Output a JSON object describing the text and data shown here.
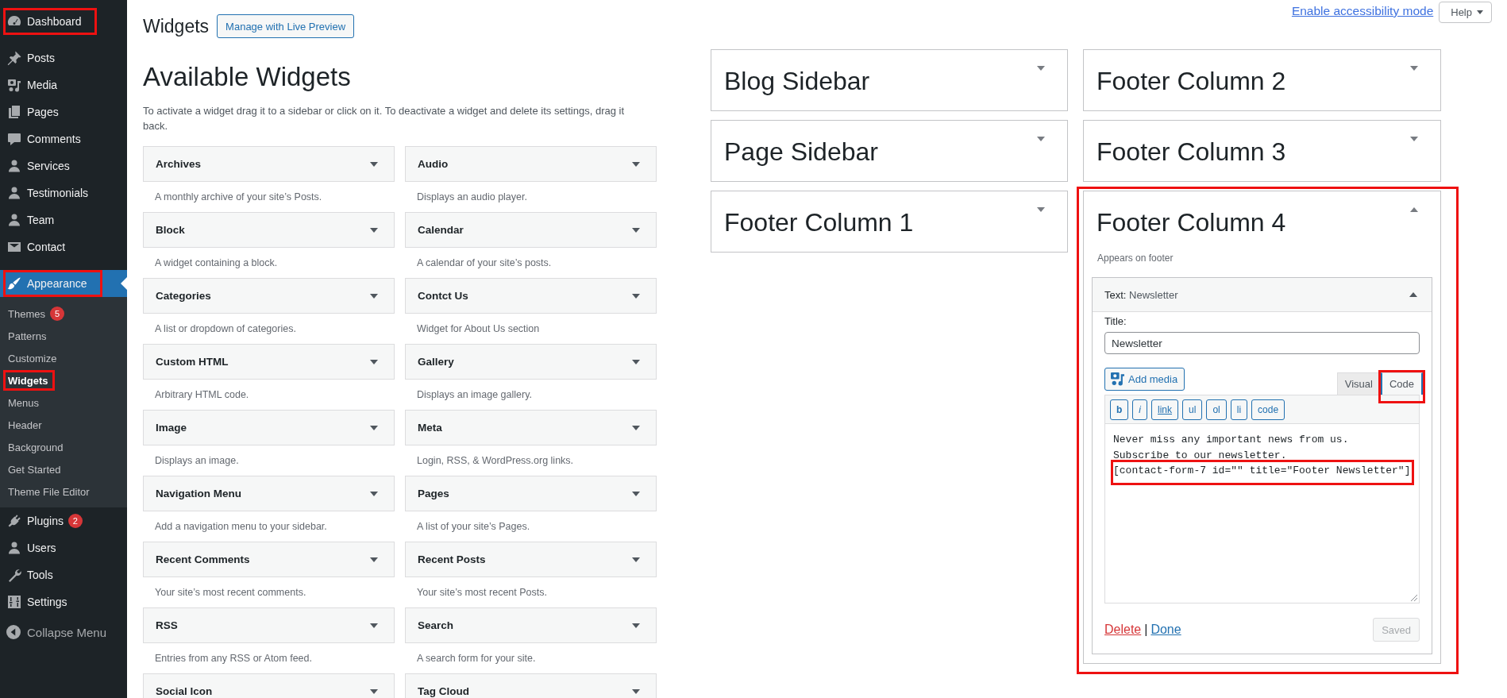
{
  "admin_menu": {
    "groups": [
      {
        "items": [
          {
            "label": "Dashboard",
            "selected": false,
            "highlighted": true
          }
        ]
      },
      {
        "items": [
          {
            "label": "Posts",
            "selected": false,
            "highlighted": false
          },
          {
            "label": "Media",
            "selected": false,
            "highlighted": false
          },
          {
            "label": "Pages",
            "selected": false,
            "highlighted": false
          },
          {
            "label": "Comments",
            "selected": false,
            "highlighted": false
          },
          {
            "label": "Services",
            "selected": false,
            "highlighted": false
          },
          {
            "label": "Testimonials",
            "selected": false,
            "highlighted": false
          },
          {
            "label": "Team",
            "selected": false,
            "highlighted": false
          },
          {
            "label": "Contact",
            "selected": false,
            "highlighted": false
          }
        ]
      },
      {
        "items": [
          {
            "label": "Appearance",
            "selected": true,
            "highlighted": true,
            "submenu": [
              {
                "label": "Themes",
                "badge": "5",
                "selected": false,
                "highlighted": false
              },
              {
                "label": "Patterns",
                "selected": false,
                "highlighted": false
              },
              {
                "label": "Customize",
                "selected": false,
                "highlighted": false
              },
              {
                "label": "Widgets",
                "selected": true,
                "highlighted": true
              },
              {
                "label": "Menus",
                "selected": false,
                "highlighted": false
              },
              {
                "label": "Header",
                "selected": false,
                "highlighted": false
              },
              {
                "label": "Background",
                "selected": false,
                "highlighted": false
              },
              {
                "label": "Get Started",
                "selected": false,
                "highlighted": false
              },
              {
                "label": "Theme File Editor",
                "selected": false,
                "highlighted": false
              }
            ]
          },
          {
            "label": "Plugins",
            "badge": "2",
            "selected": false,
            "highlighted": false
          },
          {
            "label": "Users",
            "selected": false,
            "highlighted": false
          },
          {
            "label": "Tools",
            "selected": false,
            "highlighted": false
          },
          {
            "label": "Settings",
            "selected": false,
            "highlighted": false
          }
        ]
      }
    ],
    "collapse": "Collapse Menu"
  },
  "page": {
    "title": "Widgets",
    "live_preview_button": "Manage with Live Preview",
    "accessibility_link": "Enable accessibility mode",
    "help_button": "Help"
  },
  "available_widgets": {
    "heading": "Available Widgets",
    "description": "To activate a widget drag it to a sidebar or click on it. To deactivate a widget and delete its settings, drag it back.",
    "widgets": [
      {
        "name": "Archives",
        "expanded": false,
        "description": "A monthly archive of your site’s Posts."
      },
      {
        "name": "Audio",
        "expanded": false,
        "description": "Displays an audio player."
      },
      {
        "name": "Block",
        "expanded": false,
        "description": "A widget containing a block."
      },
      {
        "name": "Calendar",
        "expanded": false,
        "description": "A calendar of your site’s posts."
      },
      {
        "name": "Categories",
        "expanded": false,
        "description": "A list or dropdown of categories."
      },
      {
        "name": "Contct Us",
        "expanded": false,
        "description": "Widget for About Us section"
      },
      {
        "name": "Custom HTML",
        "expanded": false,
        "description": "Arbitrary HTML code."
      },
      {
        "name": "Gallery",
        "expanded": false,
        "description": "Displays an image gallery."
      },
      {
        "name": "Image",
        "expanded": false,
        "description": "Displays an image."
      },
      {
        "name": "Meta",
        "expanded": false,
        "description": "Login, RSS, & WordPress.org links."
      },
      {
        "name": "Navigation Menu",
        "expanded": false,
        "description": "Add a navigation menu to your sidebar."
      },
      {
        "name": "Pages",
        "expanded": false,
        "description": "A list of your site’s Pages."
      },
      {
        "name": "Recent Comments",
        "expanded": false,
        "description": "Your site’s most recent comments."
      },
      {
        "name": "Recent Posts",
        "expanded": false,
        "description": "Your site’s most recent Posts."
      },
      {
        "name": "RSS",
        "expanded": false,
        "description": "Entries from any RSS or Atom feed."
      },
      {
        "name": "Search",
        "expanded": false,
        "description": "A search form for your site."
      },
      {
        "name": "Social Icon",
        "expanded": false
      },
      {
        "name": "Tag Cloud",
        "expanded": false
      }
    ]
  },
  "sidebar_columns": [
    {
      "areas": [
        {
          "name": "Blog Sidebar",
          "expanded": false,
          "highlighted": false
        },
        {
          "name": "Page Sidebar",
          "expanded": false,
          "highlighted": false
        },
        {
          "name": "Footer Column 1",
          "expanded": false,
          "highlighted": false
        }
      ]
    },
    {
      "areas": [
        {
          "name": "Footer Column 2",
          "expanded": false,
          "highlighted": false
        },
        {
          "name": "Footer Column 3",
          "expanded": false,
          "highlighted": false
        },
        {
          "name": "Footer Column 4",
          "expanded": true,
          "highlighted": true,
          "description": "Appears on footer",
          "widgets": [
            {
              "type_label": "Text:",
              "title": "Newsletter",
              "expanded": true,
              "form": {
                "title_label": "Title:",
                "title_value": "Newsletter",
                "add_media": "Add media",
                "tabs": [
                  {
                    "label": "Visual",
                    "selected": false,
                    "highlighted": false
                  },
                  {
                    "label": "Code",
                    "selected": true,
                    "highlighted": true
                  }
                ],
                "toolbar": [
                  {
                    "label": "b",
                    "kind": "bold"
                  },
                  {
                    "label": "i",
                    "kind": "italic"
                  },
                  {
                    "label": "link",
                    "kind": "link"
                  },
                  {
                    "label": "ul",
                    "kind": "plain"
                  },
                  {
                    "label": "ol",
                    "kind": "plain"
                  },
                  {
                    "label": "li",
                    "kind": "plain"
                  },
                  {
                    "label": "code",
                    "kind": "plain"
                  }
                ],
                "content_lines": [
                  {
                    "text": "Never miss any important news from us.",
                    "highlighted": false
                  },
                  {
                    "text": "Subscribe to our newsletter.",
                    "highlighted": false
                  },
                  {
                    "text": "[contact-form-7 id=\"\" title=\"Footer Newsletter\"]",
                    "highlighted": true
                  }
                ],
                "delete": "Delete",
                "separator": "|",
                "done": "Done",
                "save": {
                  "label": "Saved",
                  "disabled": true
                }
              }
            }
          ]
        }
      ]
    }
  ]
}
